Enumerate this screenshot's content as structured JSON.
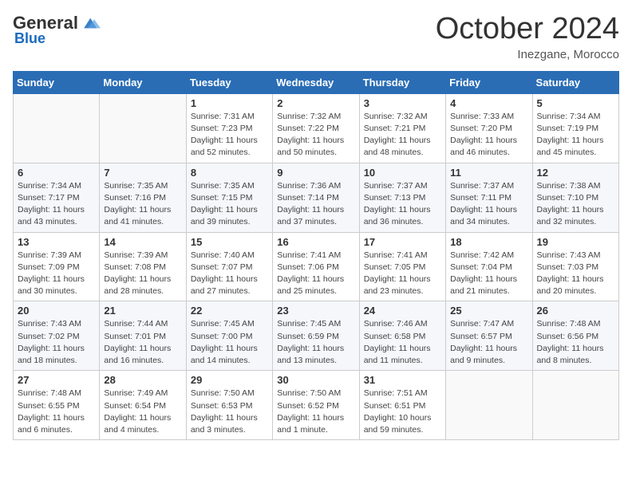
{
  "header": {
    "logo_general": "General",
    "logo_blue": "Blue",
    "month_title": "October 2024",
    "location": "Inezgane, Morocco"
  },
  "calendar": {
    "days_of_week": [
      "Sunday",
      "Monday",
      "Tuesday",
      "Wednesday",
      "Thursday",
      "Friday",
      "Saturday"
    ],
    "weeks": [
      [
        {
          "day": "",
          "detail": ""
        },
        {
          "day": "",
          "detail": ""
        },
        {
          "day": "1",
          "detail": "Sunrise: 7:31 AM\nSunset: 7:23 PM\nDaylight: 11 hours and 52 minutes."
        },
        {
          "day": "2",
          "detail": "Sunrise: 7:32 AM\nSunset: 7:22 PM\nDaylight: 11 hours and 50 minutes."
        },
        {
          "day": "3",
          "detail": "Sunrise: 7:32 AM\nSunset: 7:21 PM\nDaylight: 11 hours and 48 minutes."
        },
        {
          "day": "4",
          "detail": "Sunrise: 7:33 AM\nSunset: 7:20 PM\nDaylight: 11 hours and 46 minutes."
        },
        {
          "day": "5",
          "detail": "Sunrise: 7:34 AM\nSunset: 7:19 PM\nDaylight: 11 hours and 45 minutes."
        }
      ],
      [
        {
          "day": "6",
          "detail": "Sunrise: 7:34 AM\nSunset: 7:17 PM\nDaylight: 11 hours and 43 minutes."
        },
        {
          "day": "7",
          "detail": "Sunrise: 7:35 AM\nSunset: 7:16 PM\nDaylight: 11 hours and 41 minutes."
        },
        {
          "day": "8",
          "detail": "Sunrise: 7:35 AM\nSunset: 7:15 PM\nDaylight: 11 hours and 39 minutes."
        },
        {
          "day": "9",
          "detail": "Sunrise: 7:36 AM\nSunset: 7:14 PM\nDaylight: 11 hours and 37 minutes."
        },
        {
          "day": "10",
          "detail": "Sunrise: 7:37 AM\nSunset: 7:13 PM\nDaylight: 11 hours and 36 minutes."
        },
        {
          "day": "11",
          "detail": "Sunrise: 7:37 AM\nSunset: 7:11 PM\nDaylight: 11 hours and 34 minutes."
        },
        {
          "day": "12",
          "detail": "Sunrise: 7:38 AM\nSunset: 7:10 PM\nDaylight: 11 hours and 32 minutes."
        }
      ],
      [
        {
          "day": "13",
          "detail": "Sunrise: 7:39 AM\nSunset: 7:09 PM\nDaylight: 11 hours and 30 minutes."
        },
        {
          "day": "14",
          "detail": "Sunrise: 7:39 AM\nSunset: 7:08 PM\nDaylight: 11 hours and 28 minutes."
        },
        {
          "day": "15",
          "detail": "Sunrise: 7:40 AM\nSunset: 7:07 PM\nDaylight: 11 hours and 27 minutes."
        },
        {
          "day": "16",
          "detail": "Sunrise: 7:41 AM\nSunset: 7:06 PM\nDaylight: 11 hours and 25 minutes."
        },
        {
          "day": "17",
          "detail": "Sunrise: 7:41 AM\nSunset: 7:05 PM\nDaylight: 11 hours and 23 minutes."
        },
        {
          "day": "18",
          "detail": "Sunrise: 7:42 AM\nSunset: 7:04 PM\nDaylight: 11 hours and 21 minutes."
        },
        {
          "day": "19",
          "detail": "Sunrise: 7:43 AM\nSunset: 7:03 PM\nDaylight: 11 hours and 20 minutes."
        }
      ],
      [
        {
          "day": "20",
          "detail": "Sunrise: 7:43 AM\nSunset: 7:02 PM\nDaylight: 11 hours and 18 minutes."
        },
        {
          "day": "21",
          "detail": "Sunrise: 7:44 AM\nSunset: 7:01 PM\nDaylight: 11 hours and 16 minutes."
        },
        {
          "day": "22",
          "detail": "Sunrise: 7:45 AM\nSunset: 7:00 PM\nDaylight: 11 hours and 14 minutes."
        },
        {
          "day": "23",
          "detail": "Sunrise: 7:45 AM\nSunset: 6:59 PM\nDaylight: 11 hours and 13 minutes."
        },
        {
          "day": "24",
          "detail": "Sunrise: 7:46 AM\nSunset: 6:58 PM\nDaylight: 11 hours and 11 minutes."
        },
        {
          "day": "25",
          "detail": "Sunrise: 7:47 AM\nSunset: 6:57 PM\nDaylight: 11 hours and 9 minutes."
        },
        {
          "day": "26",
          "detail": "Sunrise: 7:48 AM\nSunset: 6:56 PM\nDaylight: 11 hours and 8 minutes."
        }
      ],
      [
        {
          "day": "27",
          "detail": "Sunrise: 7:48 AM\nSunset: 6:55 PM\nDaylight: 11 hours and 6 minutes."
        },
        {
          "day": "28",
          "detail": "Sunrise: 7:49 AM\nSunset: 6:54 PM\nDaylight: 11 hours and 4 minutes."
        },
        {
          "day": "29",
          "detail": "Sunrise: 7:50 AM\nSunset: 6:53 PM\nDaylight: 11 hours and 3 minutes."
        },
        {
          "day": "30",
          "detail": "Sunrise: 7:50 AM\nSunset: 6:52 PM\nDaylight: 11 hours and 1 minute."
        },
        {
          "day": "31",
          "detail": "Sunrise: 7:51 AM\nSunset: 6:51 PM\nDaylight: 10 hours and 59 minutes."
        },
        {
          "day": "",
          "detail": ""
        },
        {
          "day": "",
          "detail": ""
        }
      ]
    ]
  }
}
